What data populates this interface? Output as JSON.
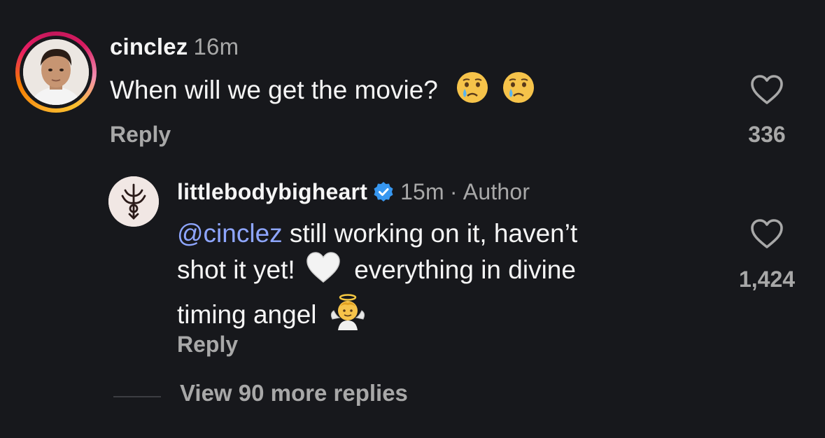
{
  "comment": {
    "username": "cinclez",
    "time": "16m",
    "text": "When will we get the movie?",
    "emojis": [
      "crying-face",
      "crying-face"
    ],
    "reply_label": "Reply",
    "like_count": "336"
  },
  "reply": {
    "username": "littlebodybigheart",
    "verified": true,
    "time": "15m",
    "separator": "·",
    "author_label": "Author",
    "mention": "@cinclez",
    "text_line1": " still working on it, haven’t",
    "text_line2a": "shot it yet!",
    "text_line2b": "everything in divine",
    "text_line3": "timing angel",
    "emojis": [
      "white-heart",
      "baby-angel"
    ],
    "reply_label": "Reply",
    "like_count": "1,424"
  },
  "view_more": "View 90 more replies",
  "colors": {
    "background": "#17181c",
    "primary_text": "#f5f5f5",
    "secondary_text": "#a8a8a8",
    "mention": "#8ea6ff",
    "verified": "#3797f0"
  }
}
